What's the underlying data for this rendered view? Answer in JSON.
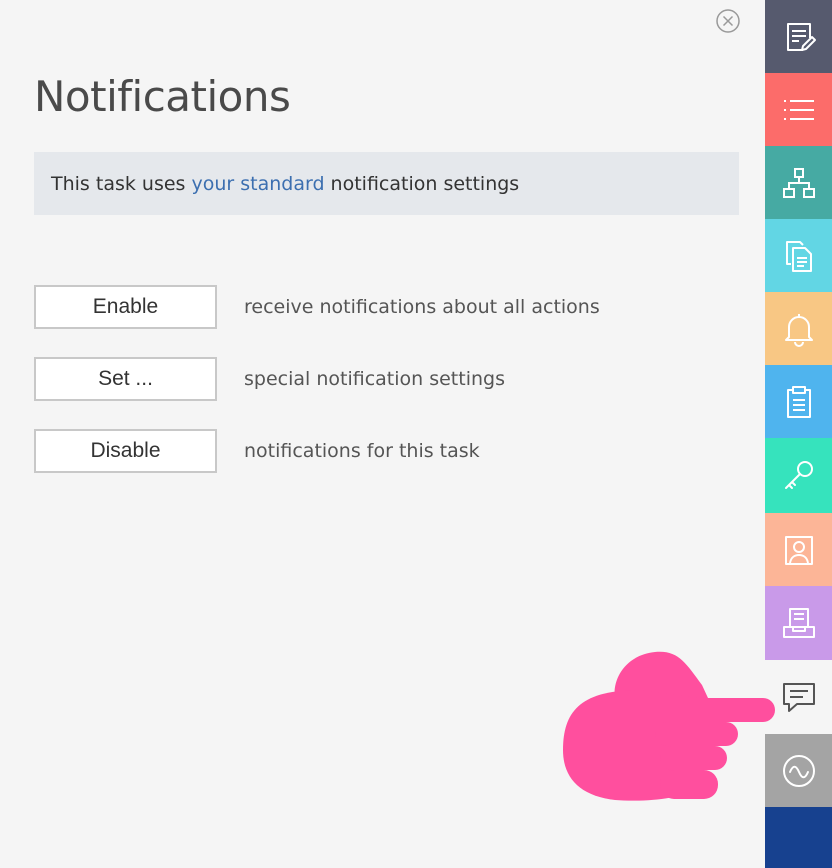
{
  "panel": {
    "title": "Notifications",
    "info": {
      "prefix": "This task uses ",
      "link": "your standard",
      "suffix": " notification settings"
    },
    "options": [
      {
        "button": "Enable",
        "description": "receive notifications about all actions"
      },
      {
        "button": "Set ...",
        "description": "special notification settings"
      },
      {
        "button": "Disable",
        "description": "notifications for this task"
      }
    ]
  },
  "sidebar": {
    "tabs": [
      {
        "icon": "edit-document-icon",
        "color": "#565a6e"
      },
      {
        "icon": "list-icon",
        "color": "#fc6c6a"
      },
      {
        "icon": "hierarchy-icon",
        "color": "#46aaa3"
      },
      {
        "icon": "documents-icon",
        "color": "#62d6e4"
      },
      {
        "icon": "bell-icon",
        "color": "#f8c784"
      },
      {
        "icon": "clipboard-icon",
        "color": "#4fb4ee"
      },
      {
        "icon": "key-icon",
        "color": "#36e3bd"
      },
      {
        "icon": "contact-card-icon",
        "color": "#fcb597"
      },
      {
        "icon": "inbox-tray-icon",
        "color": "#c99ae9"
      },
      {
        "icon": "chat-icon",
        "color": "#f5f5f5",
        "active": true
      },
      {
        "icon": "activity-wave-icon",
        "color": "#a4a4a4"
      },
      {
        "icon": "blank-tab",
        "color": "#17418f"
      }
    ]
  },
  "overlay": {
    "icon": "pointing-hand-icon",
    "color": "#ff4f9e"
  },
  "accent": {
    "link": "#3c6fb0",
    "info_bg": "#e5e8ec"
  }
}
